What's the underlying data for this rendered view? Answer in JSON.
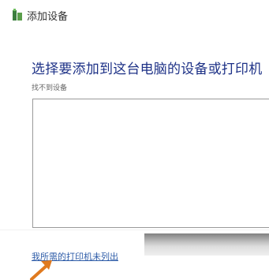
{
  "window": {
    "title": "添加设备",
    "title_icon": "add-device-icon"
  },
  "main": {
    "heading": "选择要添加到这台电脑的设备或打印机",
    "status": "找不到设备",
    "link": "我所需的打印机未列出"
  },
  "annotation": {
    "arrow_icon": "orange-arrow-icon",
    "arrow_color": "#e07a1f"
  },
  "colors": {
    "heading": "#1e3287",
    "link": "#2e5ca8"
  }
}
